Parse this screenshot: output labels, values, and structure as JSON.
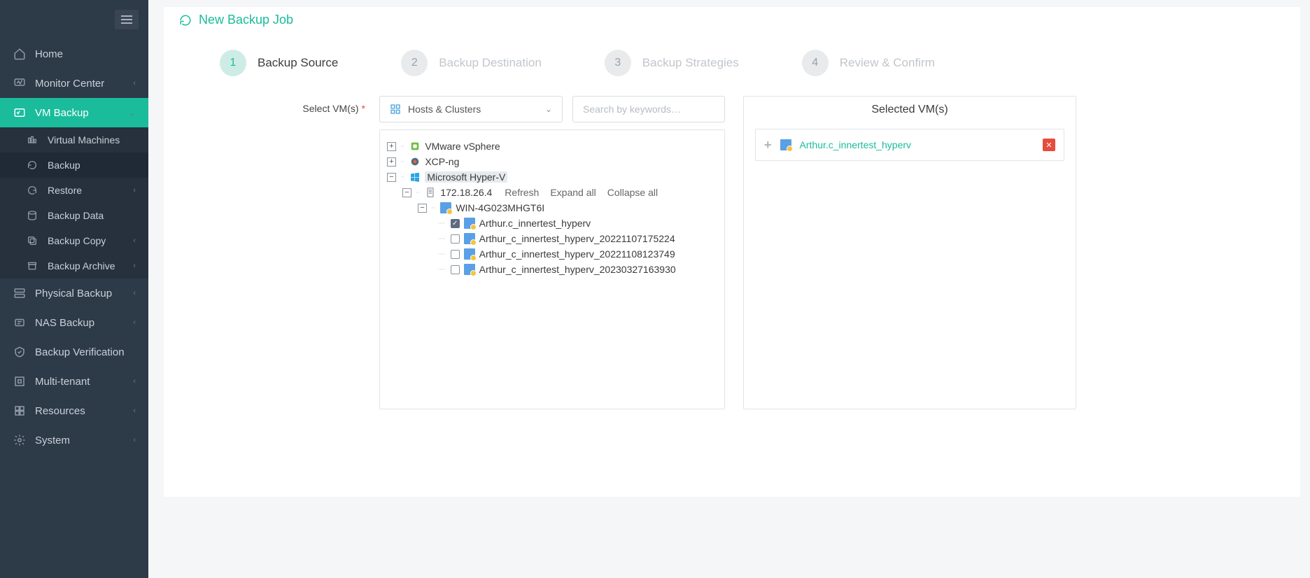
{
  "page_title": "New Backup Job",
  "sidebar": {
    "items": [
      {
        "label": "Home"
      },
      {
        "label": "Monitor Center"
      },
      {
        "label": "VM Backup"
      },
      {
        "label": "Physical Backup"
      },
      {
        "label": "NAS Backup"
      },
      {
        "label": "Backup Verification"
      },
      {
        "label": "Multi-tenant"
      },
      {
        "label": "Resources"
      },
      {
        "label": "System"
      }
    ],
    "vm_backup_sub": [
      {
        "label": "Virtual Machines"
      },
      {
        "label": "Backup"
      },
      {
        "label": "Restore"
      },
      {
        "label": "Backup Data"
      },
      {
        "label": "Backup Copy"
      },
      {
        "label": "Backup Archive"
      }
    ]
  },
  "steps": [
    {
      "num": "1",
      "label": "Backup Source"
    },
    {
      "num": "2",
      "label": "Backup Destination"
    },
    {
      "num": "3",
      "label": "Backup Strategies"
    },
    {
      "num": "4",
      "label": "Review & Confirm"
    }
  ],
  "form": {
    "select_vms_label": "Select VM(s)",
    "dropdown_value": "Hosts & Clusters",
    "search_placeholder": "Search by keywords…"
  },
  "tree": {
    "roots": {
      "vmware": "VMware vSphere",
      "xcp": "XCP-ng",
      "hyperv": "Microsoft Hyper-V"
    },
    "host_ip": "172.18.26.4",
    "host_actions": {
      "refresh": "Refresh",
      "expand": "Expand all",
      "collapse": "Collapse all"
    },
    "cluster": "WIN-4G023MHGT6I",
    "vms": [
      {
        "name": "Arthur.c_innertest_hyperv",
        "checked": true
      },
      {
        "name": "Arthur_c_innertest_hyperv_20221107175224",
        "checked": false
      },
      {
        "name": "Arthur_c_innertest_hyperv_20221108123749",
        "checked": false
      },
      {
        "name": "Arthur_c_innertest_hyperv_20230327163930",
        "checked": false
      }
    ]
  },
  "selected_panel": {
    "title": "Selected VM(s)",
    "items": [
      {
        "name": "Arthur.c_innertest_hyperv"
      }
    ]
  }
}
